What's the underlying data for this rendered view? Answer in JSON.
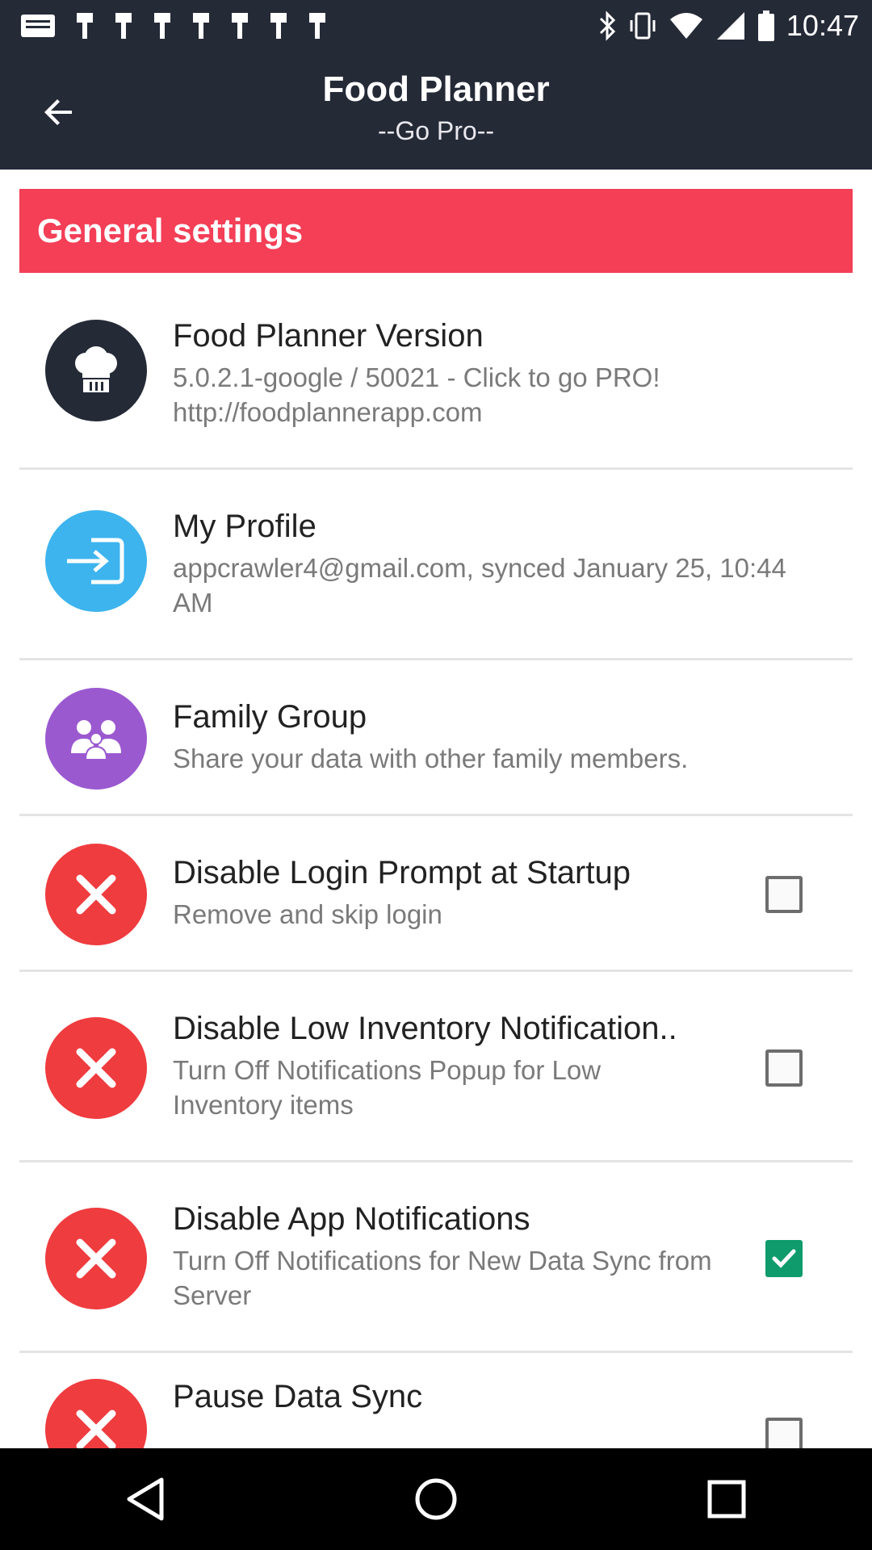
{
  "status_bar": {
    "time": "10:47",
    "left_icons": [
      "message-icon",
      "notification-icon",
      "notification-icon",
      "notification-icon",
      "notification-icon",
      "notification-icon",
      "notification-icon",
      "notification-icon"
    ],
    "right_icons": [
      "bluetooth-icon",
      "vibrate-icon",
      "wifi-icon",
      "signal-icon",
      "battery-icon"
    ]
  },
  "app_bar": {
    "title": "Food Planner",
    "subtitle": "--Go Pro--",
    "back_icon": "back-arrow-icon"
  },
  "section": {
    "title": "General settings"
  },
  "settings": [
    {
      "title": "Food Planner Version",
      "subtitle": "5.0.2.1-google / 50021 - Click to go PRO! http://foodplannerapp.com",
      "icon": "chef-hat-icon",
      "icon_color": "#252a37",
      "checkbox": null
    },
    {
      "title": "My Profile",
      "subtitle": "appcrawler4@gmail.com, synced January 25, 10:44 AM",
      "icon": "login-icon",
      "icon_color": "#3db4ee",
      "checkbox": null
    },
    {
      "title": "Family Group",
      "subtitle": "Share your data with other family members.",
      "icon": "family-icon",
      "icon_color": "#9b59d0",
      "checkbox": null
    },
    {
      "title": "Disable Login Prompt at Startup",
      "subtitle": "Remove and skip login",
      "icon": "close-icon",
      "icon_color": "#ef3c3f",
      "checkbox": false
    },
    {
      "title": "Disable Low Inventory Notification..",
      "subtitle": "Turn Off Notifications Popup for Low Inventory items",
      "icon": "close-icon",
      "icon_color": "#ef3c3f",
      "checkbox": false
    },
    {
      "title": "Disable App Notifications",
      "subtitle": "Turn Off Notifications for New Data Sync from Server",
      "icon": "close-icon",
      "icon_color": "#ef3c3f",
      "checkbox": true
    },
    {
      "title": "Pause Data Sync",
      "subtitle": "",
      "icon": "close-icon",
      "icon_color": "#ef3c3f",
      "checkbox": false
    }
  ],
  "nav_bar": {
    "buttons": [
      "back-triangle-icon",
      "home-circle-icon",
      "recents-square-icon"
    ]
  },
  "colors": {
    "app_bar": "#252a37",
    "section_header": "#f43f57",
    "list_background": "#f3f3f3",
    "checked": "#0f9b6b"
  }
}
